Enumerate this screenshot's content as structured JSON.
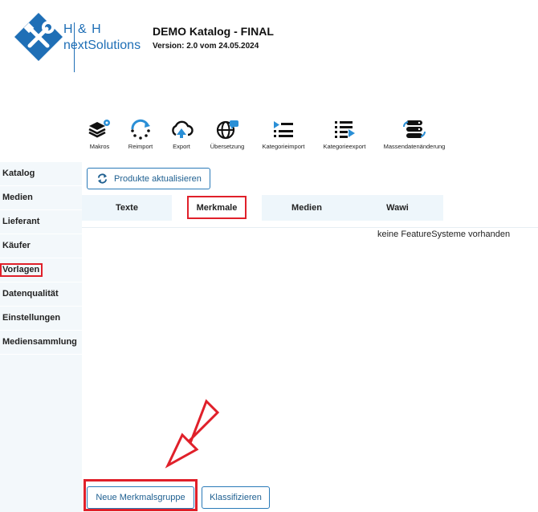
{
  "logo": {
    "line1": "H & H",
    "line2": "nextSolutions"
  },
  "catalog": {
    "title": "DEMO Katalog - FINAL",
    "version": "Version: 2.0 vom 24.05.2024"
  },
  "toolbar": [
    {
      "label": "Makros",
      "icon": "layers-gear-icon"
    },
    {
      "label": "Reimport",
      "icon": "refresh-dots-icon"
    },
    {
      "label": "Export",
      "icon": "cloud-upload-icon"
    },
    {
      "label": "Übersetzung",
      "icon": "globe-chat-icon"
    },
    {
      "label": "Kategorieimport",
      "icon": "list-import-icon"
    },
    {
      "label": "Kategorieexport",
      "icon": "list-export-icon"
    },
    {
      "label": "Massendatenänderung",
      "icon": "database-refresh-icon"
    }
  ],
  "sidebar": {
    "items": [
      {
        "label": "Katalog"
      },
      {
        "label": "Medien"
      },
      {
        "label": "Lieferant"
      },
      {
        "label": "Käufer"
      },
      {
        "label": "Vorlagen"
      },
      {
        "label": "Datenqualität"
      },
      {
        "label": "Einstellungen"
      },
      {
        "label": "Mediensammlung"
      }
    ]
  },
  "main": {
    "refresh_label": "Produkte aktualisieren",
    "tabs": [
      {
        "label": "Texte"
      },
      {
        "label": "Merkmale"
      },
      {
        "label": "Medien"
      },
      {
        "label": "Wawi"
      }
    ],
    "empty_message": "keine FeatureSysteme vorhanden",
    "new_group_label": "Neue Merkmalsgruppe",
    "classify_label": "Klassifizieren"
  },
  "colors": {
    "accent": "#1f6fb6",
    "highlight": "#e0202a",
    "sidebar_bg": "#f3f8fb"
  }
}
